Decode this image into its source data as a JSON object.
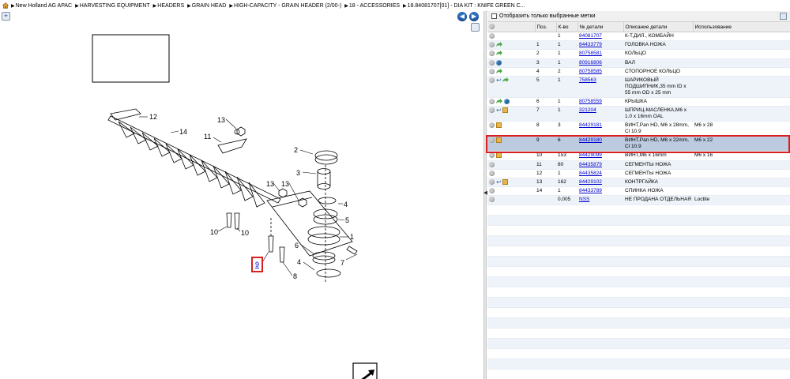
{
  "breadcrumb": {
    "items": [
      "New Holland AG APAC",
      "HARVESTING EQUIPMENT",
      "HEADERS",
      "GRAIN HEAD",
      "HIGH-CAPACITY - GRAIN HEADER (2/00-)",
      "18 - ACCESSORIES",
      "18.84081707[01] - DIA KIT : KNIFE GREEN C..."
    ]
  },
  "diagram": {
    "callouts": [
      "12",
      "14",
      "13",
      "11",
      "2",
      "3",
      "13",
      "13",
      "4",
      "5",
      "10",
      "10",
      "1",
      "6",
      "7",
      "9",
      "4",
      "8"
    ]
  },
  "filter": {
    "label": "Отобразить только выбранные метки"
  },
  "table": {
    "headers": [
      "",
      "Поз.",
      "К-во",
      "№ детали",
      "Описание детали",
      "Использование"
    ],
    "rows": [
      {
        "pos": "",
        "qty": "1",
        "part": "84081707",
        "desc": "К-Т,ДИЛ., КОМБАЙН",
        "use": "",
        "icons": []
      },
      {
        "pos": "1",
        "qty": "1",
        "part": "84433779",
        "desc": "ГОЛОВКА НОЖА",
        "use": "",
        "icons": [
          "arrow"
        ]
      },
      {
        "pos": "2",
        "qty": "1",
        "part": "80758581",
        "desc": "КОЛЬЦО",
        "use": "",
        "icons": [
          "arrow"
        ]
      },
      {
        "pos": "3",
        "qty": "1",
        "part": "80916806",
        "desc": "ВАЛ",
        "use": "",
        "icons": [
          "globe"
        ]
      },
      {
        "pos": "4",
        "qty": "2",
        "part": "80758585",
        "desc": "СТОПОРНОЕ КОЛЬЦО",
        "use": "",
        "icons": [
          "arrow"
        ]
      },
      {
        "pos": "5",
        "qty": "1",
        "part": "758563",
        "desc": "ШАРИКОВЫЙ ПОДШИПНИК,35 mm ID x 55 mm OD x 25 mm",
        "use": "",
        "icons": [
          "hook",
          "arrow"
        ]
      },
      {
        "pos": "6",
        "qty": "1",
        "part": "80758559",
        "desc": "КРЫШКА",
        "use": "",
        "icons": [
          "arrow",
          "globe"
        ]
      },
      {
        "pos": "7",
        "qty": "1",
        "part": "321204",
        "desc": "ШПРИЦ-МАСЛЕНКА,M6 x 1.0 x 16mm OAL",
        "use": "",
        "icons": [
          "hook",
          "box"
        ]
      },
      {
        "pos": "8",
        "qty": "3",
        "part": "84429181",
        "desc": "ВИНТ,Pan HD, M6 x 28mm, Cl 10.9",
        "use": "M6 x 28",
        "icons": [
          "box"
        ]
      },
      {
        "pos": "9",
        "qty": "6",
        "part": "84429180",
        "desc": "ВИНТ,Pan HD, M6 x 22mm, Cl 10.9",
        "use": "M6 x 22",
        "icons": [
          "box"
        ]
      },
      {
        "pos": "10",
        "qty": "153",
        "part": "84429099",
        "desc": "ВИНТ,M6 x 16mm",
        "use": "M6 x 16",
        "icons": [
          "box"
        ]
      },
      {
        "pos": "11",
        "qty": "80",
        "part": "84435879",
        "desc": "СЕГМЕНТЫ НОЖА",
        "use": "",
        "icons": []
      },
      {
        "pos": "12",
        "qty": "1",
        "part": "84435824",
        "desc": "СЕГМЕНТЫ НОЖА",
        "use": "",
        "icons": []
      },
      {
        "pos": "13",
        "qty": "162",
        "part": "84429102",
        "desc": "КОНТРГАЙКА",
        "use": "",
        "icons": [
          "hook",
          "box"
        ]
      },
      {
        "pos": "14",
        "qty": "1",
        "part": "84433789",
        "desc": "СПИНКА НОЖА",
        "use": "",
        "icons": []
      },
      {
        "pos": "",
        "qty": "0,005",
        "part": "NSS",
        "desc": "НЕ ПРОДАНА ОТДЕЛЬНАЯ",
        "use": "Loctite",
        "icons": []
      }
    ]
  },
  "colors": {
    "highlight": "#d91f1f",
    "selected_row": "#bccbe0",
    "link": "#0000cc"
  }
}
